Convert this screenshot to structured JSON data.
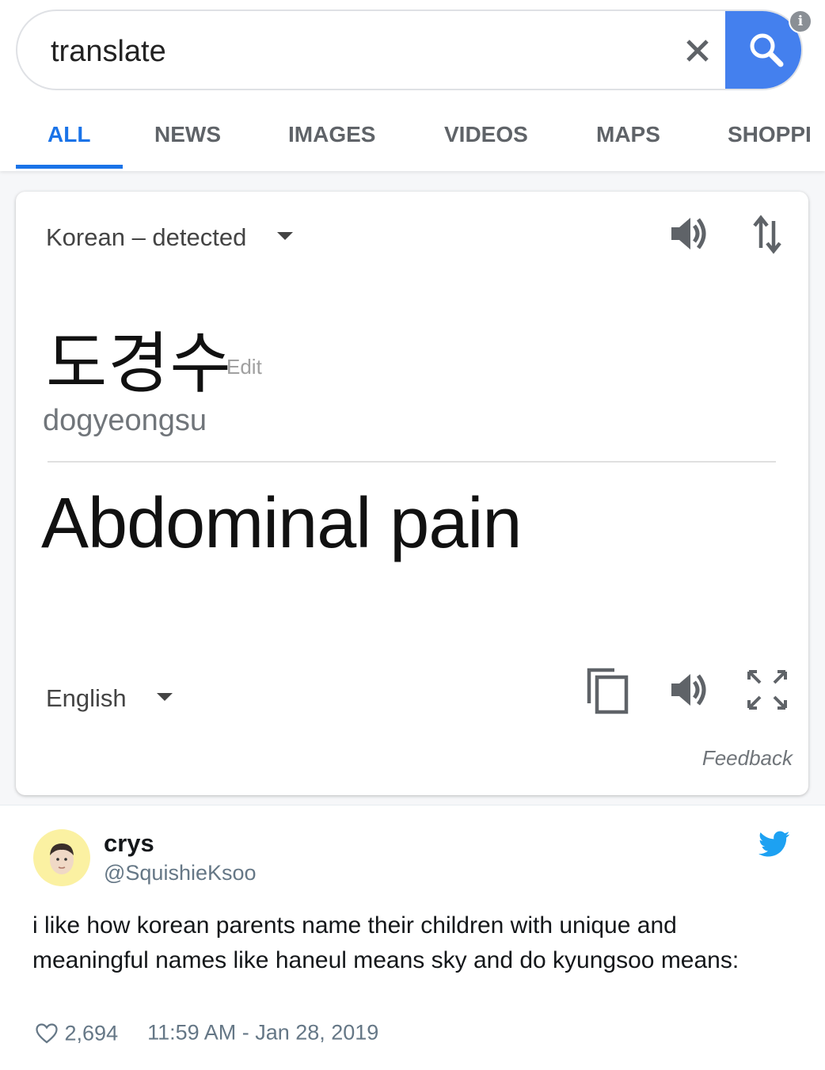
{
  "search": {
    "query": "translate",
    "info_badge": "i"
  },
  "tabs": [
    {
      "label": "ALL"
    },
    {
      "label": "NEWS"
    },
    {
      "label": "IMAGES"
    },
    {
      "label": "VIDEOS"
    },
    {
      "label": "MAPS"
    },
    {
      "label": "SHOPPI"
    }
  ],
  "translate_card": {
    "source_language": "Korean – detected",
    "source_text": "도경수",
    "edit_label": "Edit",
    "romanization": "dogyeongsu",
    "translation": "Abdominal pain",
    "target_language": "English",
    "feedback_label": "Feedback",
    "icons": [
      "speaker-icon",
      "swap-languages-icon",
      "copy-icon",
      "speaker-icon",
      "fullscreen-icon"
    ]
  },
  "tweet": {
    "author_name": "crys",
    "author_handle": "@SquishieKsoo",
    "body": "i like how korean parents name their children with unique and meaningful names like haneul means sky and do kyungsoo means:",
    "likes": "2,694",
    "timestamp": "11:59 AM - Jan 28, 2019"
  },
  "colors": {
    "accent_blue": "#1a73e8",
    "search_button": "#4480ee",
    "twitter_blue": "#1da1f2",
    "avatar_bg": "#fbf1a2"
  }
}
